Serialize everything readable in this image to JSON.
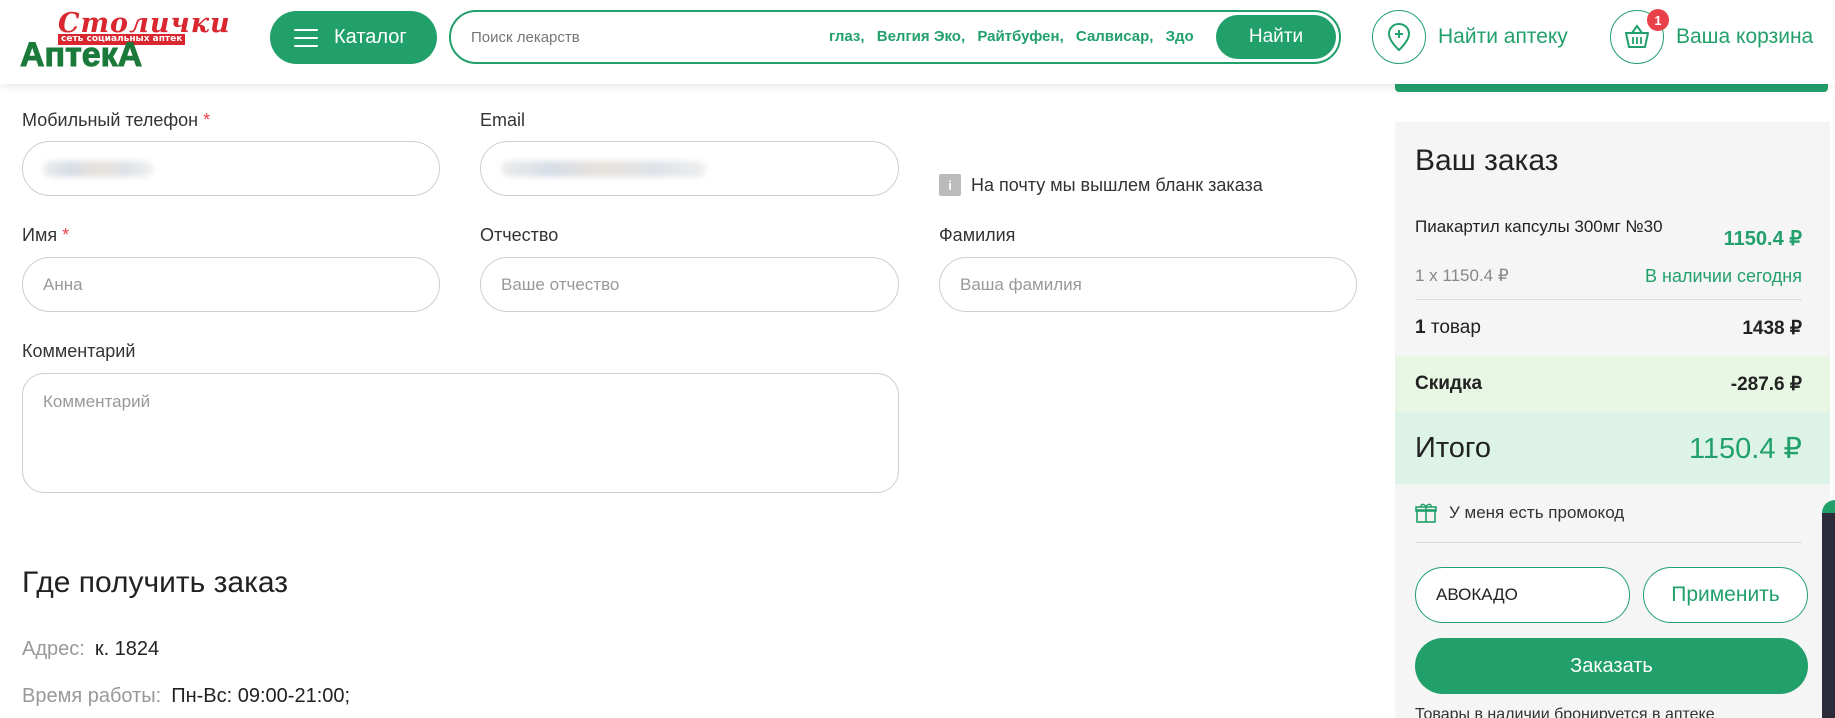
{
  "header": {
    "logo_top": "Столички",
    "logo_sub": "сеть социальных аптек",
    "logo_main": "АптекА",
    "catalog_label": "Каталог",
    "search_placeholder": "Поиск лекарств",
    "search_hints": [
      "глаз,",
      "Велгия Эко,",
      "Райтбуфен,",
      "Салвисар,",
      "Здо"
    ],
    "find_label": "Найти",
    "pharmacy_label": "Найти аптеку",
    "cart_label": "Ваша корзина",
    "cart_count": "1"
  },
  "form": {
    "phone_label": "Мобильный телефон",
    "email_label": "Email",
    "email_note": "На почту мы вышлем бланк заказа",
    "info_icon_glyph": "i",
    "required_mark": "*",
    "name_label": "Имя",
    "name_placeholder": "Анна",
    "patronymic_label": "Отчество",
    "patronymic_placeholder": "Ваше отчество",
    "surname_label": "Фамилия",
    "surname_placeholder": "Ваша фамилия",
    "comment_label": "Комментарий",
    "comment_placeholder": "Комментарий"
  },
  "pickup": {
    "title": "Где получить заказ",
    "address_key": "Адрес:",
    "address_value": "к. 1824",
    "hours_key": "Время работы:",
    "hours_value": "Пн-Вс: 09:00-21:00;"
  },
  "order": {
    "title": "Ваш заказ",
    "product_name": "Пиакартил капсулы 300мг №30",
    "product_price": "1150.4 ₽",
    "product_qty": "1 x 1150.4 ₽",
    "product_stock": "В наличии сегодня",
    "count_num": "1",
    "count_word": "товар",
    "count_value": "1438 ₽",
    "discount_label": "Скидка",
    "discount_value": "-287.6 ₽",
    "total_label": "Итого",
    "total_value": "1150.4 ₽",
    "promo_label": "У меня есть промокод",
    "promo_value": "АВОКАДО",
    "apply_label": "Применить",
    "order_label": "Заказать",
    "footnote": "Товары в наличии бронируется в аптеке"
  },
  "colors": {
    "brand_green": "#22a06b",
    "logo_red": "#d9262f",
    "logo_green": "#1b7a3a",
    "badge_red": "#e8414a"
  },
  "icons": [
    "menu-icon",
    "location-pin-icon",
    "basket-icon",
    "info-icon",
    "gift-icon"
  ]
}
